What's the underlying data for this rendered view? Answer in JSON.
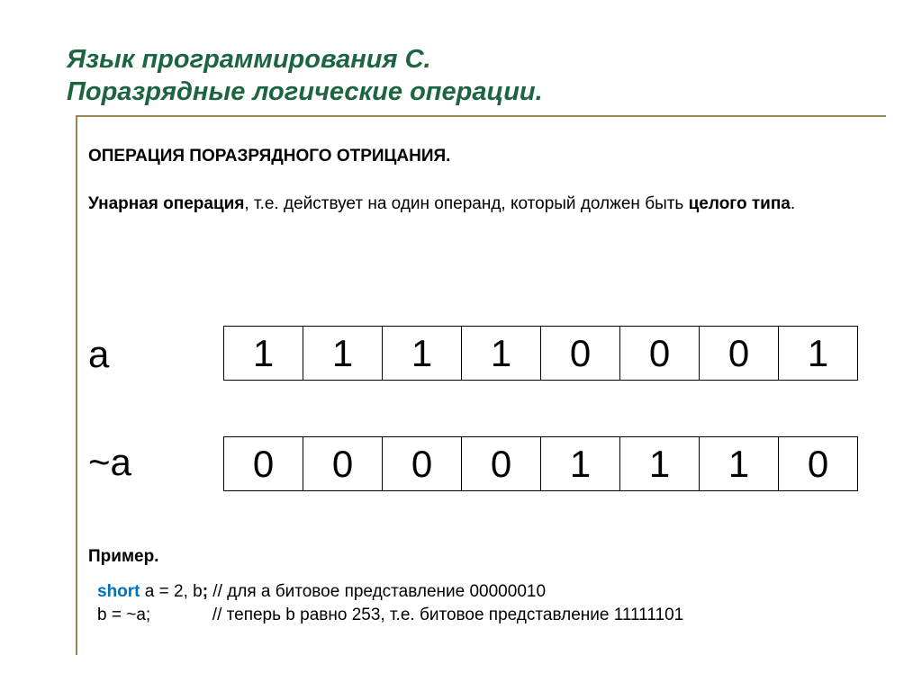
{
  "title": {
    "line1": "Язык программирования С.",
    "line2": " Поразрядные логические операции."
  },
  "subheading": "ОПЕРАЦИЯ ПОРАЗРЯДНОГО ОТРИЦАНИЯ.",
  "description": {
    "strong1": "Унарная операция",
    "middle": ", т.е. действует на один операнд, который должен быть ",
    "strong2": "целого типа",
    "tail": "."
  },
  "variable_a": {
    "label": "a",
    "bits": [
      "1",
      "1",
      "1",
      "1",
      "0",
      "0",
      "0",
      "1"
    ]
  },
  "variable_na": {
    "label": "~a",
    "bits": [
      "0",
      "0",
      "0",
      "0",
      "1",
      "1",
      "1",
      "0"
    ]
  },
  "example": {
    "label": "Пример.",
    "line1": {
      "kw": "short",
      "decl_pre_b": " a = 2, b",
      "semi": ";",
      "comment": " // для а битовое представление 00000010"
    },
    "line2": {
      "code": " b = ~a;",
      "spacer": "             ",
      "comment": "// теперь b равно 253, т.е. битовое представление 11111101"
    }
  }
}
